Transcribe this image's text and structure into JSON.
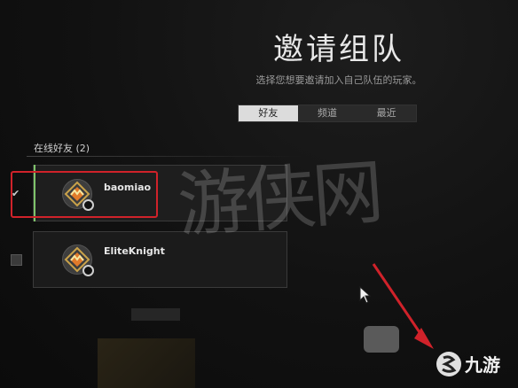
{
  "header": {
    "title": "邀请组队",
    "subtitle": "选择您想要邀请加入自己队伍的玩家。"
  },
  "tabs": [
    {
      "label": "好友",
      "active": true
    },
    {
      "label": "频道",
      "active": false
    },
    {
      "label": "最近",
      "active": false
    }
  ],
  "section": {
    "label": "在线好友 (2)"
  },
  "friends": [
    {
      "name": "baomiao",
      "selected": true,
      "avatar_icon": "compass-emblem-icon"
    },
    {
      "name": "EliteKnight",
      "selected": false,
      "avatar_icon": "compass-emblem-icon"
    }
  ],
  "watermark": {
    "text": "游侠网"
  },
  "logo": {
    "text": "九游"
  },
  "colors": {
    "highlight": "#d0222a",
    "selected_bar": "#7ec36a",
    "tab_active": "#dcdcdc"
  }
}
